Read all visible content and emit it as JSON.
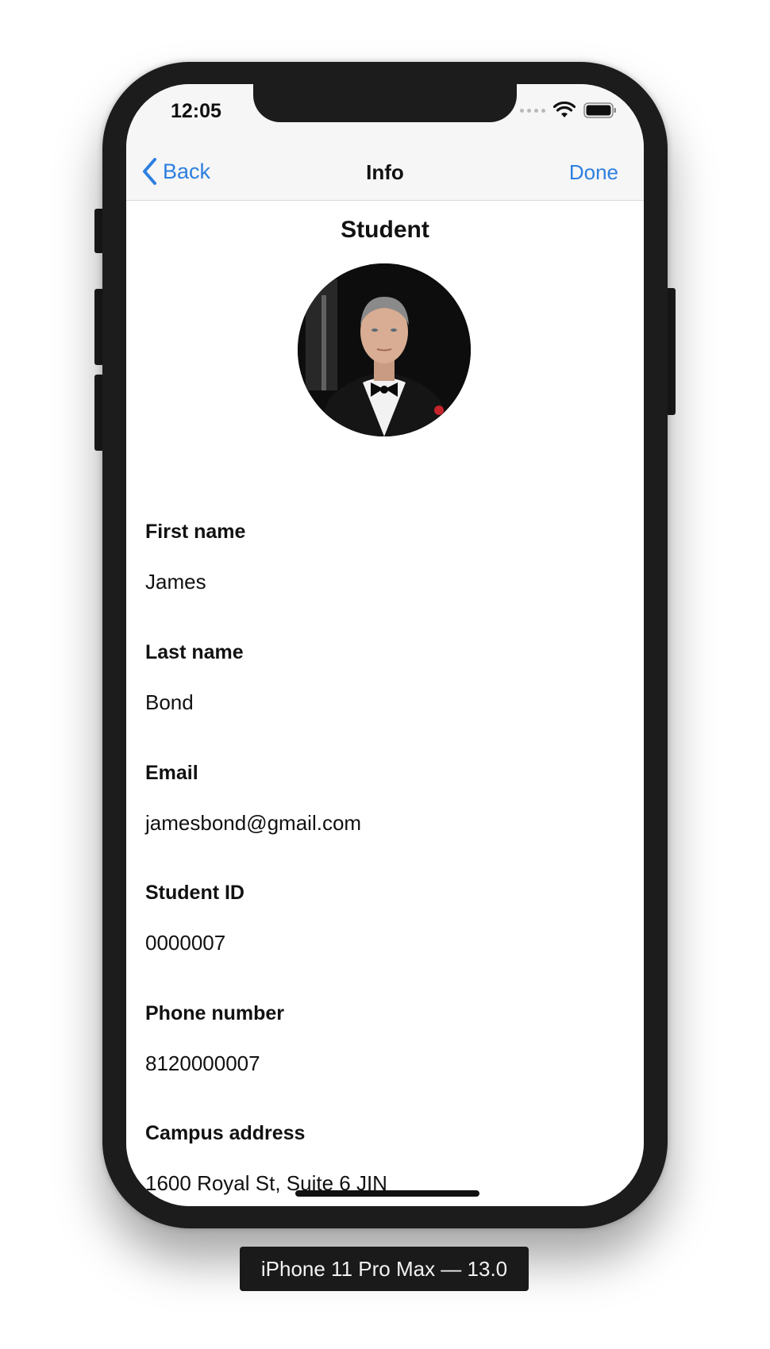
{
  "status_bar": {
    "time": "12:05"
  },
  "nav": {
    "back_label": "Back",
    "title": "Info",
    "done_label": "Done"
  },
  "profile": {
    "section_title": "Student"
  },
  "fields": [
    {
      "label": "First name",
      "value": "James"
    },
    {
      "label": "Last name",
      "value": "Bond"
    },
    {
      "label": "Email",
      "value": "jamesbond@gmail.com"
    },
    {
      "label": "Student ID",
      "value": "0000007"
    },
    {
      "label": "Phone number",
      "value": "8120000007"
    },
    {
      "label": "Campus address",
      "value": "1600 Royal St, Suite 6 JIN"
    }
  ],
  "device_label": "iPhone 11 Pro Max — 13.0",
  "colors": {
    "accent": "#2d7fe0",
    "nav_background": "#f6f6f6",
    "frame": "#1c1c1c"
  },
  "icons": {
    "back": "chevron-left-icon",
    "wifi": "wifi-icon",
    "battery": "battery-icon",
    "signal": "signal-icon"
  }
}
